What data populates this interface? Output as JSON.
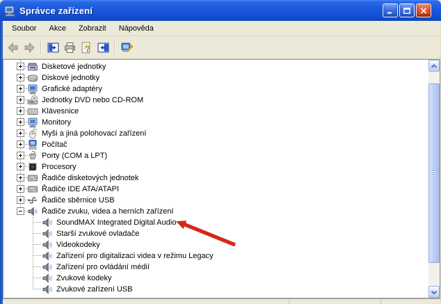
{
  "window": {
    "title": "Správce zařízení",
    "icon": "device-manager-computer-icon",
    "controls": {
      "minimize": "minimize-button",
      "maximize": "maximize-button",
      "close": "close-button"
    }
  },
  "menubar": {
    "items": [
      {
        "label": "Soubor"
      },
      {
        "label": "Akce"
      },
      {
        "label": "Zobrazit"
      },
      {
        "label": "Nápověda"
      }
    ]
  },
  "toolbar": {
    "buttons": [
      {
        "name": "back",
        "icon": "back-arrow-icon",
        "enabled": false
      },
      {
        "name": "forward",
        "icon": "forward-arrow-icon",
        "enabled": false
      },
      {
        "name": "show-console-tree",
        "icon": "console-tree-icon",
        "enabled": true
      },
      {
        "name": "print",
        "icon": "printer-icon",
        "enabled": true
      },
      {
        "name": "help",
        "icon": "help-question-icon",
        "enabled": true
      },
      {
        "name": "show-details-pane",
        "icon": "details-pane-icon",
        "enabled": true
      },
      {
        "name": "help-and-support",
        "icon": "computer-help-icon",
        "enabled": true
      }
    ]
  },
  "tree": {
    "items": [
      {
        "label": "Disketové jednotky",
        "icon": "floppy-drive-icon",
        "level": 0,
        "state": "collapsed"
      },
      {
        "label": "Diskové jednotky",
        "icon": "hard-disk-icon",
        "level": 0,
        "state": "collapsed"
      },
      {
        "label": "Grafické adaptéry",
        "icon": "display-adapter-icon",
        "level": 0,
        "state": "collapsed"
      },
      {
        "label": "Jednotky DVD nebo CD-ROM",
        "icon": "cdrom-drive-icon",
        "level": 0,
        "state": "collapsed"
      },
      {
        "label": "Klávesnice",
        "icon": "keyboard-icon",
        "level": 0,
        "state": "collapsed"
      },
      {
        "label": "Monitory",
        "icon": "monitor-icon",
        "level": 0,
        "state": "collapsed"
      },
      {
        "label": "Myši a jiná polohovací zařízení",
        "icon": "mouse-icon",
        "level": 0,
        "state": "collapsed"
      },
      {
        "label": "Počítač",
        "icon": "computer-icon",
        "level": 0,
        "state": "collapsed"
      },
      {
        "label": "Porty (COM a LPT)",
        "icon": "port-icon",
        "level": 0,
        "state": "collapsed"
      },
      {
        "label": "Procesory",
        "icon": "processor-icon",
        "level": 0,
        "state": "collapsed"
      },
      {
        "label": "Řadiče disketových jednotek",
        "icon": "controller-icon",
        "level": 0,
        "state": "collapsed"
      },
      {
        "label": "Řadiče IDE ATA/ATAPI",
        "icon": "controller-icon",
        "level": 0,
        "state": "collapsed"
      },
      {
        "label": "Řadiče sběrnice USB",
        "icon": "usb-icon",
        "level": 0,
        "state": "collapsed"
      },
      {
        "label": "Řadiče zvuku, videa a herních zařízení",
        "icon": "speaker-icon",
        "level": 0,
        "state": "expanded"
      },
      {
        "label": "SoundMAX Integrated Digital Audio",
        "icon": "speaker-icon",
        "level": 1
      },
      {
        "label": "Starší zvukové ovladače",
        "icon": "speaker-icon",
        "level": 1
      },
      {
        "label": "Videokodeky",
        "icon": "speaker-icon",
        "level": 1
      },
      {
        "label": "Zařízení pro digitalizaci videa v režimu Legacy",
        "icon": "speaker-icon",
        "level": 1
      },
      {
        "label": "Zařízení pro ovládání médií",
        "icon": "speaker-icon",
        "level": 1
      },
      {
        "label": "Zvukové kodeky",
        "icon": "speaker-icon",
        "level": 1
      },
      {
        "label": "Zvukové zařízení USB",
        "icon": "speaker-icon",
        "level": 1
      }
    ]
  },
  "annotation": {
    "type": "red-arrow",
    "points_to": "SoundMAX Integrated Digital Audio",
    "color": "#d6281a"
  },
  "colors": {
    "titlebar_blue": "#1a58dc",
    "frame_beige": "#ece9d8",
    "content_white": "#ffffff",
    "arrow_red": "#d6281a",
    "scrollbar_thumb": "#bccdf6"
  }
}
